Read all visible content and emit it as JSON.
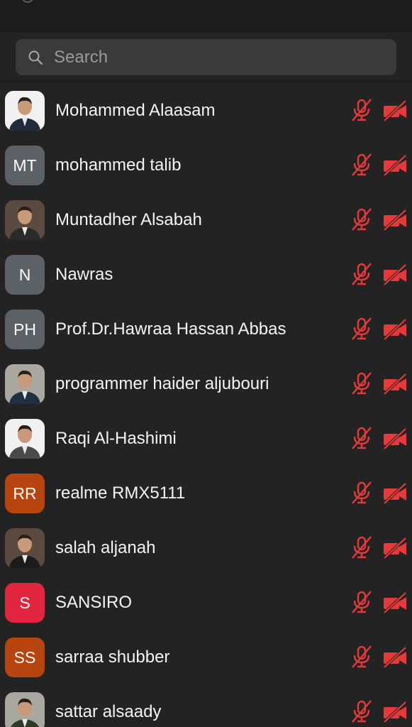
{
  "search": {
    "placeholder": "Search",
    "icon": "search-icon"
  },
  "status_color": "#e5393a",
  "participants": [
    {
      "name": "Mohammed Alaasam",
      "avatar_type": "photo",
      "initials": "",
      "avatar_color": ""
    },
    {
      "name": "mohammed talib",
      "avatar_type": "initials",
      "initials": "MT",
      "avatar_color": "#5c6166"
    },
    {
      "name": "Muntadher Alsabah",
      "avatar_type": "photo",
      "initials": "",
      "avatar_color": ""
    },
    {
      "name": "Nawras",
      "avatar_type": "initials",
      "initials": "N",
      "avatar_color": "#5c6166"
    },
    {
      "name": "Prof.Dr.Hawraa Hassan Abbas",
      "avatar_type": "initials",
      "initials": "PH",
      "avatar_color": "#5c6166"
    },
    {
      "name": "programmer haider aljubouri",
      "avatar_type": "photo",
      "initials": "",
      "avatar_color": ""
    },
    {
      "name": "Raqi Al-Hashimi",
      "avatar_type": "photo",
      "initials": "",
      "avatar_color": ""
    },
    {
      "name": "realme RMX5111",
      "avatar_type": "initials",
      "initials": "RR",
      "avatar_color": "#b8440f"
    },
    {
      "name": "salah aljanah",
      "avatar_type": "photo",
      "initials": "",
      "avatar_color": ""
    },
    {
      "name": "SANSIRO",
      "avatar_type": "initials",
      "initials": "S",
      "avatar_color": "#e1253f"
    },
    {
      "name": "sarraa shubber",
      "avatar_type": "initials",
      "initials": "SS",
      "avatar_color": "#b8440f"
    },
    {
      "name": "sattar alsaady",
      "avatar_type": "photo",
      "initials": "",
      "avatar_color": ""
    }
  ]
}
